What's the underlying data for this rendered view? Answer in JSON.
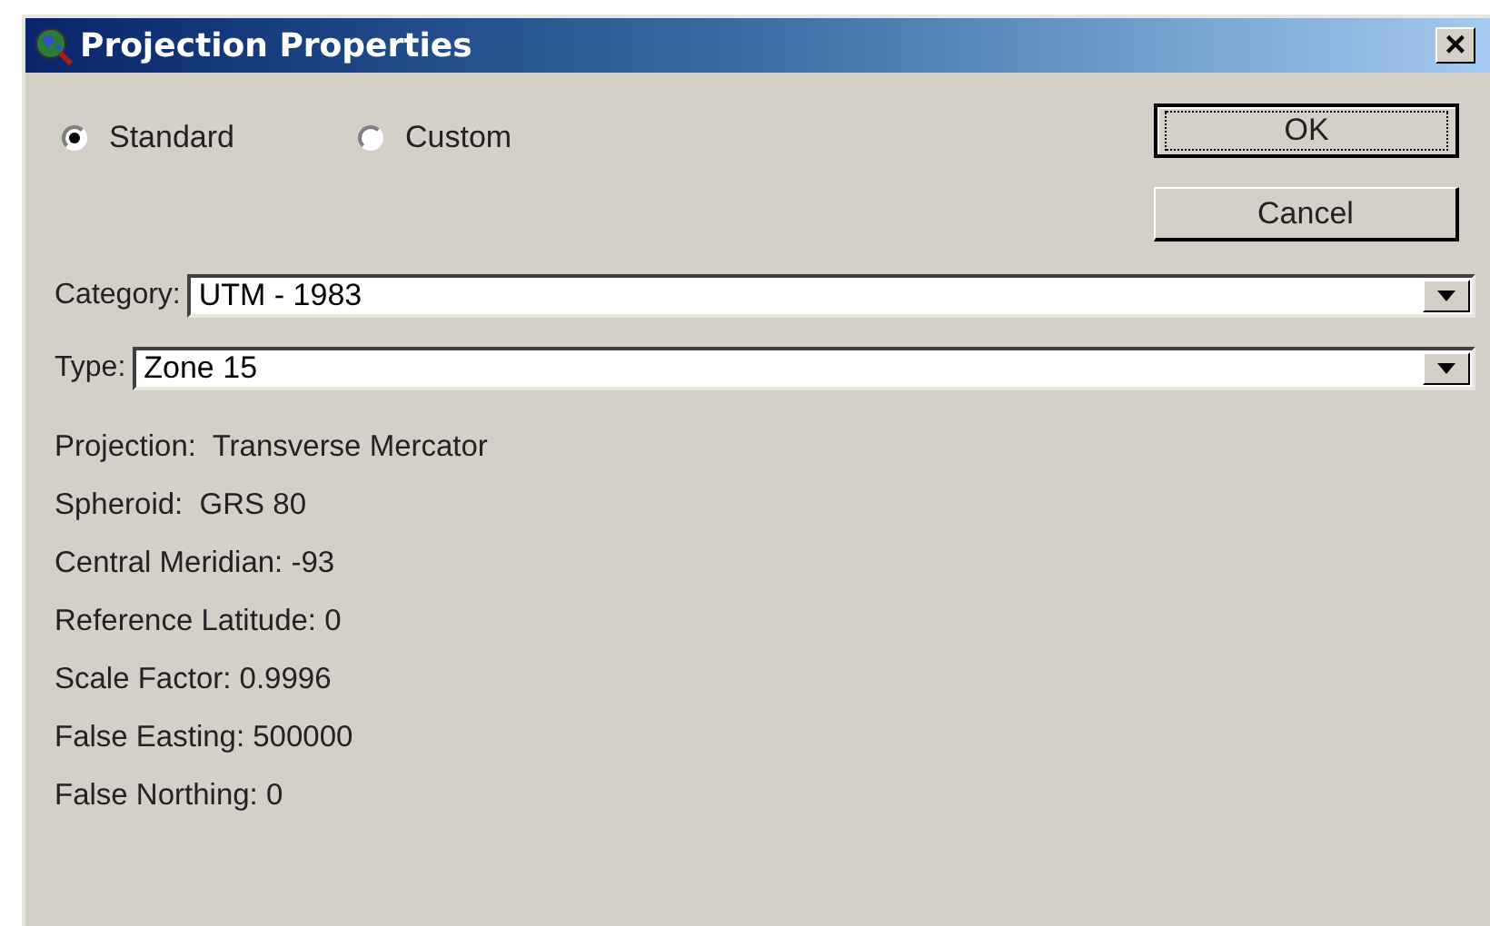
{
  "window": {
    "title": "Projection Properties",
    "close": "×"
  },
  "mode": [
    {
      "label": "Standard",
      "selected": true
    },
    {
      "label": "Custom",
      "selected": false
    }
  ],
  "buttons": [
    {
      "label": "OK",
      "focused": true
    },
    {
      "label": "Cancel",
      "focused": false
    }
  ],
  "fields": [
    {
      "label": "Category:",
      "value": "UTM - 1983"
    },
    {
      "label": "Type:",
      "value": "Zone 15"
    }
  ],
  "properties": [
    "Projection:  Transverse Mercator",
    "Spheroid:  GRS 80",
    "Central Meridian: -93",
    "Reference Latitude: 0",
    "Scale Factor: 0.9996",
    "False Easting: 500000",
    "False Northing: 0"
  ]
}
